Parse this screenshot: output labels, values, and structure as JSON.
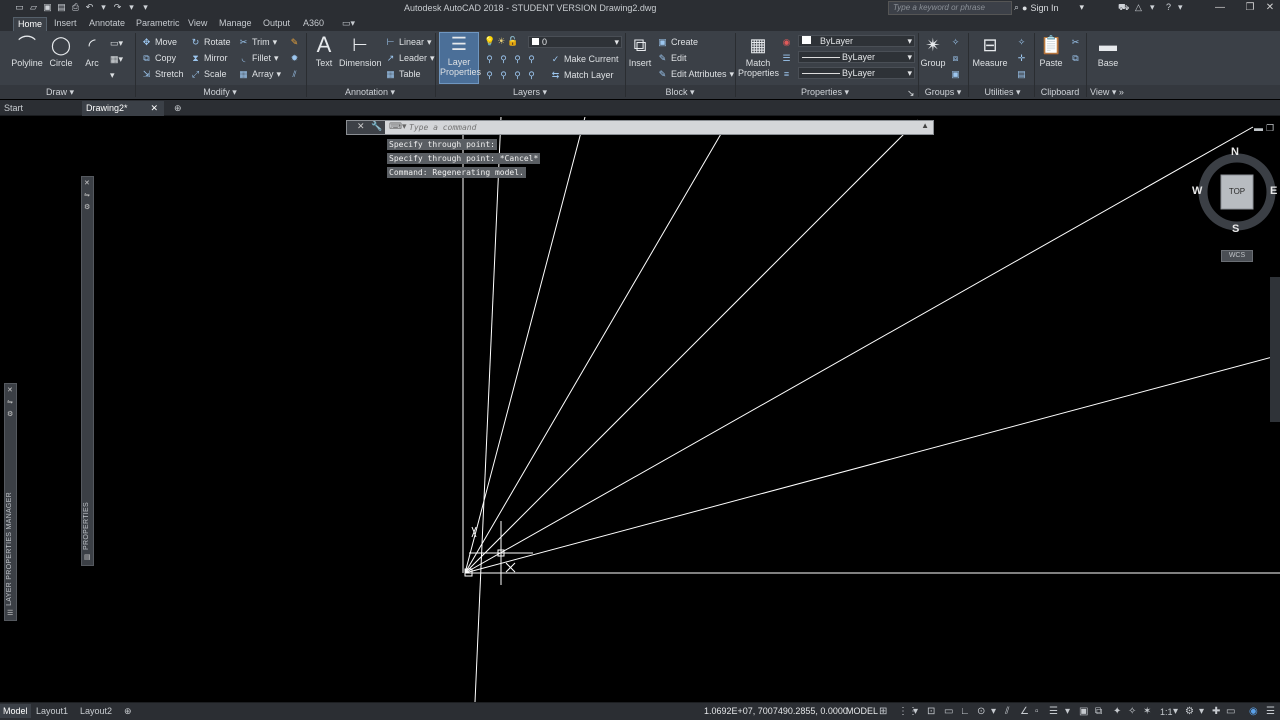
{
  "window": {
    "title": "Autodesk AutoCAD 2018 - STUDENT VERSION    Drawing2.dwg",
    "search_placeholder": "Type a keyword or phrase",
    "signin_label": "Sign In"
  },
  "ribbon_tabs": [
    "Home",
    "Insert",
    "Annotate",
    "Parametric",
    "View",
    "Manage",
    "Output",
    "A360"
  ],
  "ribbon": {
    "draw": {
      "label": "Draw",
      "polyline": "Polyline",
      "circle": "Circle",
      "arc": "Arc"
    },
    "modify": {
      "label": "Modify",
      "move": "Move",
      "rotate": "Rotate",
      "trim": "Trim",
      "copy": "Copy",
      "mirror": "Mirror",
      "fillet": "Fillet",
      "stretch": "Stretch",
      "scale": "Scale",
      "array": "Array"
    },
    "annotation": {
      "label": "Annotation",
      "text": "Text",
      "dimension": "Dimension",
      "linear": "Linear",
      "leader": "Leader",
      "table": "Table"
    },
    "layers": {
      "label": "Layers",
      "layer_properties": "Layer Properties",
      "current_layer": "0",
      "make_current": "Make Current",
      "match_layer": "Match Layer"
    },
    "block": {
      "label": "Block",
      "insert": "Insert",
      "create": "Create",
      "edit": "Edit",
      "edit_attributes": "Edit Attributes"
    },
    "properties": {
      "label": "Properties",
      "match_properties": "Match Properties",
      "color": "ByLayer",
      "linetype": "ByLayer",
      "lineweight": "ByLayer"
    },
    "groups": {
      "label": "Groups",
      "group": "Group"
    },
    "utilities": {
      "label": "Utilities",
      "measure": "Measure"
    },
    "clipboard": {
      "label": "Clipboard",
      "paste": "Paste"
    },
    "view": {
      "label": "View",
      "base": "Base"
    }
  },
  "file_tabs": {
    "start": "Start",
    "drawing": "Drawing2*"
  },
  "command": {
    "placeholder": "Type a command",
    "history": [
      "Specify through point:",
      "Specify through point: *Cancel*",
      "Command: Regenerating model."
    ]
  },
  "palettes": {
    "properties": "PROPERTIES",
    "layer_manager": "LAYER PROPERTIES MANAGER"
  },
  "viewcube": {
    "n": "N",
    "s": "S",
    "e": "E",
    "w": "W",
    "face": "TOP",
    "wcs": "WCS"
  },
  "layout_tabs": [
    "Model",
    "Layout1",
    "Layout2"
  ],
  "status": {
    "coords": "1.0692E+07, 7007490.2855, 0.0000",
    "model": "MODEL",
    "scale": "1:1"
  }
}
